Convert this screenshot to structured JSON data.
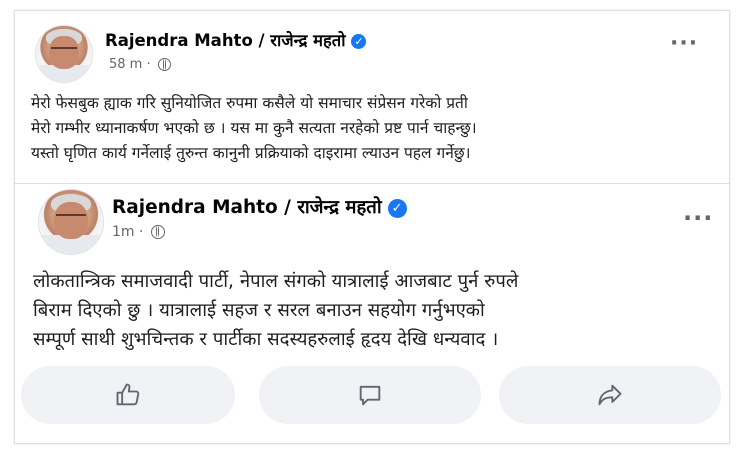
{
  "post_outer": {
    "author": "Rajendra Mahto / राजेन्द्र महतो",
    "timestamp": "58 m",
    "separator": "·",
    "body_lines": [
      "मेरो फेसबुक ह्याक गरि सुनियोजित रुपमा कसैले यो समाचार संप्रेसन गरेको प्रती",
      "मेरो गम्भीर ध्यानाकर्षण भएको छ । यस  मा कुनै सत्यता नरहेको प्रष्ट पार्न चाहन्छु।",
      "यस्तो घृणित कार्य गर्नेलाई तुरुन्त कानुनी प्रक्रियाको दाइरामा ल्याउन पहल गर्नेछु।"
    ]
  },
  "post_inner": {
    "author": "Rajendra Mahto / राजेन्द्र महतो",
    "timestamp": "1m",
    "separator": "·",
    "body_lines": [
      "लोकतान्त्रिक समाजवादी पार्टी, नेपाल संगको यात्रालाई आजबाट पुर्न रुपले",
      "बिराम दिएको छु । यात्रालाई सहज र सरल बनाउन सहयोग गर्नुभएको",
      "सम्पूर्ण साथी शुभचिन्तक र पार्टीका सदस्यहरुलाई हृदय देखि धन्यवाद ।"
    ]
  },
  "icons": {
    "verified": "✓",
    "more": "···"
  },
  "colors": {
    "verified_blue": "#1877f2",
    "meta_gray": "#65676b",
    "button_bg": "#f0f2f5"
  }
}
